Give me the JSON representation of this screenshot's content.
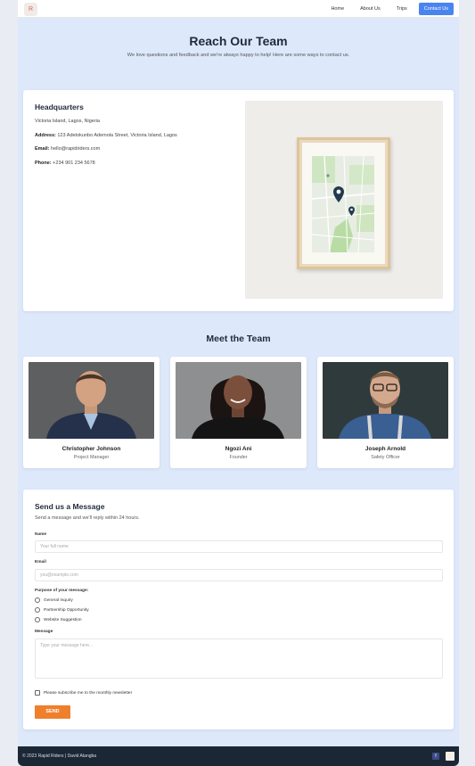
{
  "nav": {
    "logo_mark": "R",
    "links": [
      "Home",
      "About Us",
      "Trips"
    ],
    "cta": "Contact Us"
  },
  "hero": {
    "title": "Reach Our Team",
    "subtitle": "We love questions and feedback and we're always happy to help! Here are some ways to contact us."
  },
  "headquarters": {
    "title": "Headquarters",
    "location": "Victoria Island, Lagos, Nigeria",
    "address_label": "Address:",
    "address": "123 Adetokunbo Ademola Street, Victoria Island, Lagos",
    "email_label": "Email:",
    "email": "hello@rapidriders.com",
    "phone_label": "Phone:",
    "phone": "+234 901 234 5678"
  },
  "team": {
    "title": "Meet the Team",
    "members": [
      {
        "name": "Christopher Johnson",
        "role": "Project Manager"
      },
      {
        "name": "Ngozi Ani",
        "role": "Founder"
      },
      {
        "name": "Joseph Arnold",
        "role": "Safety Officer"
      }
    ]
  },
  "form": {
    "title": "Send us a Message",
    "subtitle": "Send a message and we'll reply within 24 hours.",
    "name_label": "Name",
    "name_placeholder": "Your full name",
    "email_label": "Email",
    "email_placeholder": "you@example.com",
    "purpose_label": "Purpose of your message:",
    "purposes": [
      "General Inquiry",
      "Partnership Opportunity",
      "Website Suggestion"
    ],
    "message_label": "Message",
    "message_placeholder": "Type your message here...",
    "newsletter_label": "Please subscribe me to the monthly newsletter",
    "submit_label": "SEND"
  },
  "footer": {
    "copyright": "© 2023 Rapid Riders | David Atangba",
    "icon_label": "f"
  },
  "colors": {
    "accent": "#4a84ef",
    "send": "#f07f2c",
    "page_bg": "#dde8fb",
    "footer_bg": "#1c2735"
  }
}
